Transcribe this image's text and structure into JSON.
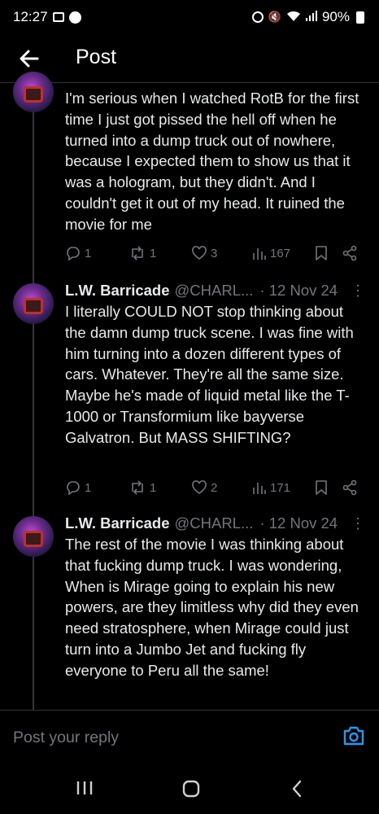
{
  "status_bar": {
    "time": "12:27",
    "battery": "90%",
    "icons": [
      "gallery-icon",
      "messenger-icon",
      "alarm-icon",
      "mute-icon",
      "wifi-icon",
      "signal-icon",
      "battery-icon"
    ]
  },
  "header": {
    "title": "Post",
    "back_icon": "arrow-left-icon"
  },
  "tweets": [
    {
      "text": "I'm serious when I watched RotB for the first time I just got pissed the hell off when he turned into a dump truck out of nowhere, because I expected them to show us that it was a hologram, but they didn't. And I couldn't get it out of my head. It ruined the movie for me",
      "replies": "1",
      "reposts": "1",
      "likes": "3",
      "views": "167"
    },
    {
      "author": "L.W. Barricade",
      "handle": "@CHARL...",
      "date": "· 12 Nov 24",
      "text": "I literally COULD NOT stop thinking about the damn dump truck scene.  I was fine with him turning into a dozen different types of cars. Whatever. They're all the same size. Maybe he's made of liquid metal like the T-1000 or Transformium like bayverse Galvatron. But MASS SHIFTING?",
      "replies": "1",
      "reposts": "1",
      "likes": "2",
      "views": "171"
    },
    {
      "author": "L.W. Barricade",
      "handle": "@CHARL...",
      "date": "· 12 Nov 24",
      "text": "The rest of the movie I was thinking about that fucking dump truck. I was wondering, When is Mirage going to explain his new powers, are they limitless why did they even need stratosphere, when Mirage could just turn into a Jumbo Jet and fucking fly everyone to Peru all the same!"
    }
  ],
  "reply_bar": {
    "placeholder": "Post your reply",
    "icon": "camera-icon",
    "accent": "#1d9bf0"
  },
  "nav_bar": {
    "icons": [
      "recent-apps-icon",
      "home-icon",
      "back-icon"
    ]
  },
  "colors": {
    "background": "#000000",
    "text": "#e7e9ea",
    "muted": "#71767b",
    "accent": "#1d9bf0"
  }
}
